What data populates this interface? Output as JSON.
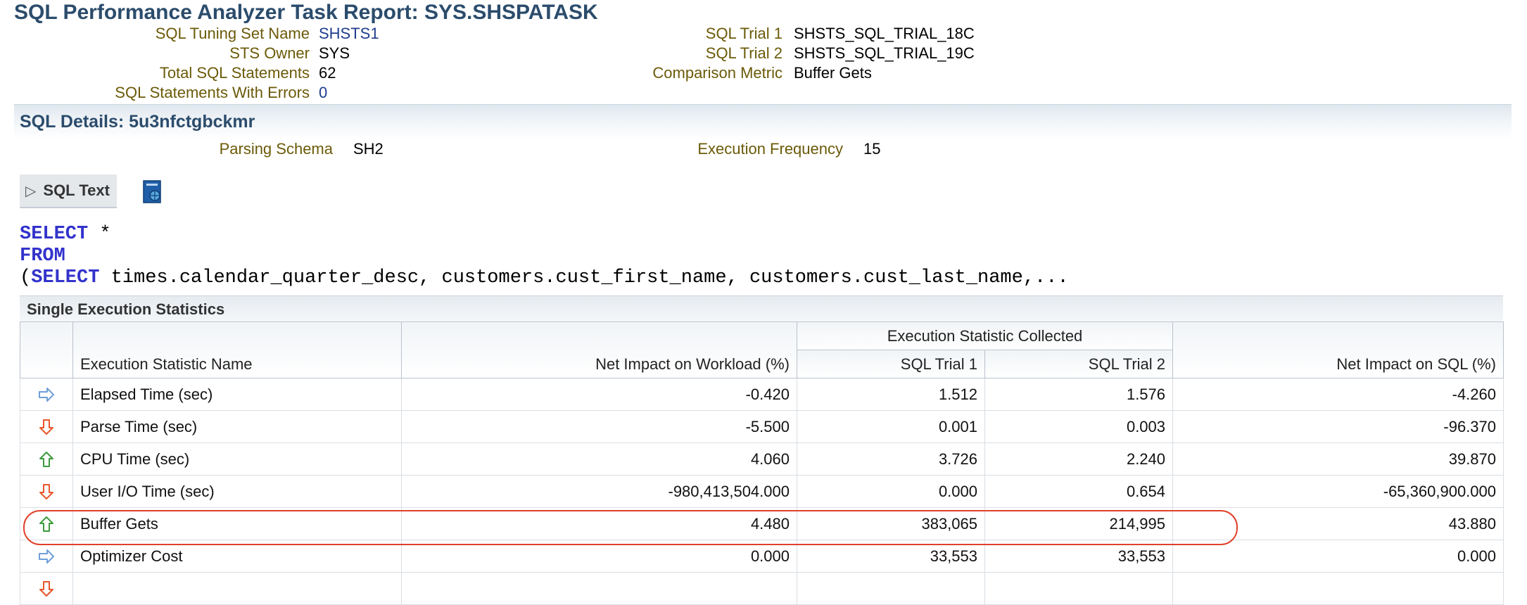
{
  "report": {
    "title": "SQL Performance Analyzer Task Report: SYS.SHSPATASK",
    "left_fields": [
      {
        "label": "SQL Tuning Set Name",
        "value": "SHSTS1",
        "link": true
      },
      {
        "label": "STS Owner",
        "value": "SYS",
        "link": false
      },
      {
        "label": "Total SQL Statements",
        "value": "62",
        "link": false
      },
      {
        "label": "SQL Statements With Errors",
        "value": "0",
        "link": true
      }
    ],
    "right_fields": [
      {
        "label": "SQL Trial 1",
        "value": "SHSTS_SQL_TRIAL_18C"
      },
      {
        "label": "SQL Trial 2",
        "value": "SHSTS_SQL_TRIAL_19C"
      },
      {
        "label": "Comparison Metric",
        "value": "Buffer Gets"
      }
    ]
  },
  "details": {
    "title": "SQL Details: 5u3nfctgbckmr",
    "parsing_schema_label": "Parsing Schema",
    "parsing_schema_value": "SH2",
    "exec_freq_label": "Execution Frequency",
    "exec_freq_value": "15",
    "sql_text_toggle": "SQL Text",
    "sql_text_toggle_icon": "disclosure-triangle-right",
    "doc_icon": "report-document-icon"
  },
  "sql": {
    "line1_kw": "SELECT",
    "line1_rest": " *",
    "line2_kw": "FROM",
    "line3_paren": "(",
    "line3_kw": "SELECT",
    "line3_rest": " times.calendar_quarter_desc, customers.cust_first_name, customers.cust_last_name,..."
  },
  "stats": {
    "section_title": "Single Execution Statistics",
    "group_header": "Execution Statistic Collected",
    "headers": [
      "Execution Statistic Name",
      "Net Impact on Workload (%)",
      "SQL Trial 1",
      "SQL Trial 2",
      "Net Impact on SQL (%)"
    ],
    "rows": [
      {
        "icon": "arrow-right",
        "name": "Elapsed Time (sec)",
        "workload": "-0.420",
        "trial1": "1.512",
        "trial2": "1.576",
        "sql": "-4.260"
      },
      {
        "icon": "arrow-down",
        "name": "Parse Time (sec)",
        "workload": "-5.500",
        "trial1": "0.001",
        "trial2": "0.003",
        "sql": "-96.370"
      },
      {
        "icon": "arrow-up",
        "name": "CPU Time (sec)",
        "workload": "4.060",
        "trial1": "3.726",
        "trial2": "2.240",
        "sql": "39.870"
      },
      {
        "icon": "arrow-down",
        "name": "User I/O Time (sec)",
        "workload": "-980,413,504.000",
        "trial1": "0.000",
        "trial2": "0.654",
        "sql": "-65,360,900.000"
      },
      {
        "icon": "arrow-up",
        "name": "Buffer Gets",
        "workload": "4.480",
        "trial1": "383,065",
        "trial2": "214,995",
        "sql": "43.880"
      },
      {
        "icon": "arrow-right",
        "name": "Optimizer Cost",
        "workload": "0.000",
        "trial1": "33,553",
        "trial2": "33,553",
        "sql": "0.000"
      },
      {
        "icon": "arrow-down",
        "name": "",
        "workload": "",
        "trial1": "",
        "trial2": "",
        "sql": ""
      }
    ]
  },
  "colors": {
    "title": "#2b4c6c",
    "label": "#6b5a08",
    "link": "#1f3d8f",
    "keyword": "#3333cc",
    "arrow_neutral": "#6f9fd8",
    "arrow_regressed": "#e8562a",
    "arrow_improved": "#3c9a3c",
    "highlight_ring": "#e0402a"
  }
}
